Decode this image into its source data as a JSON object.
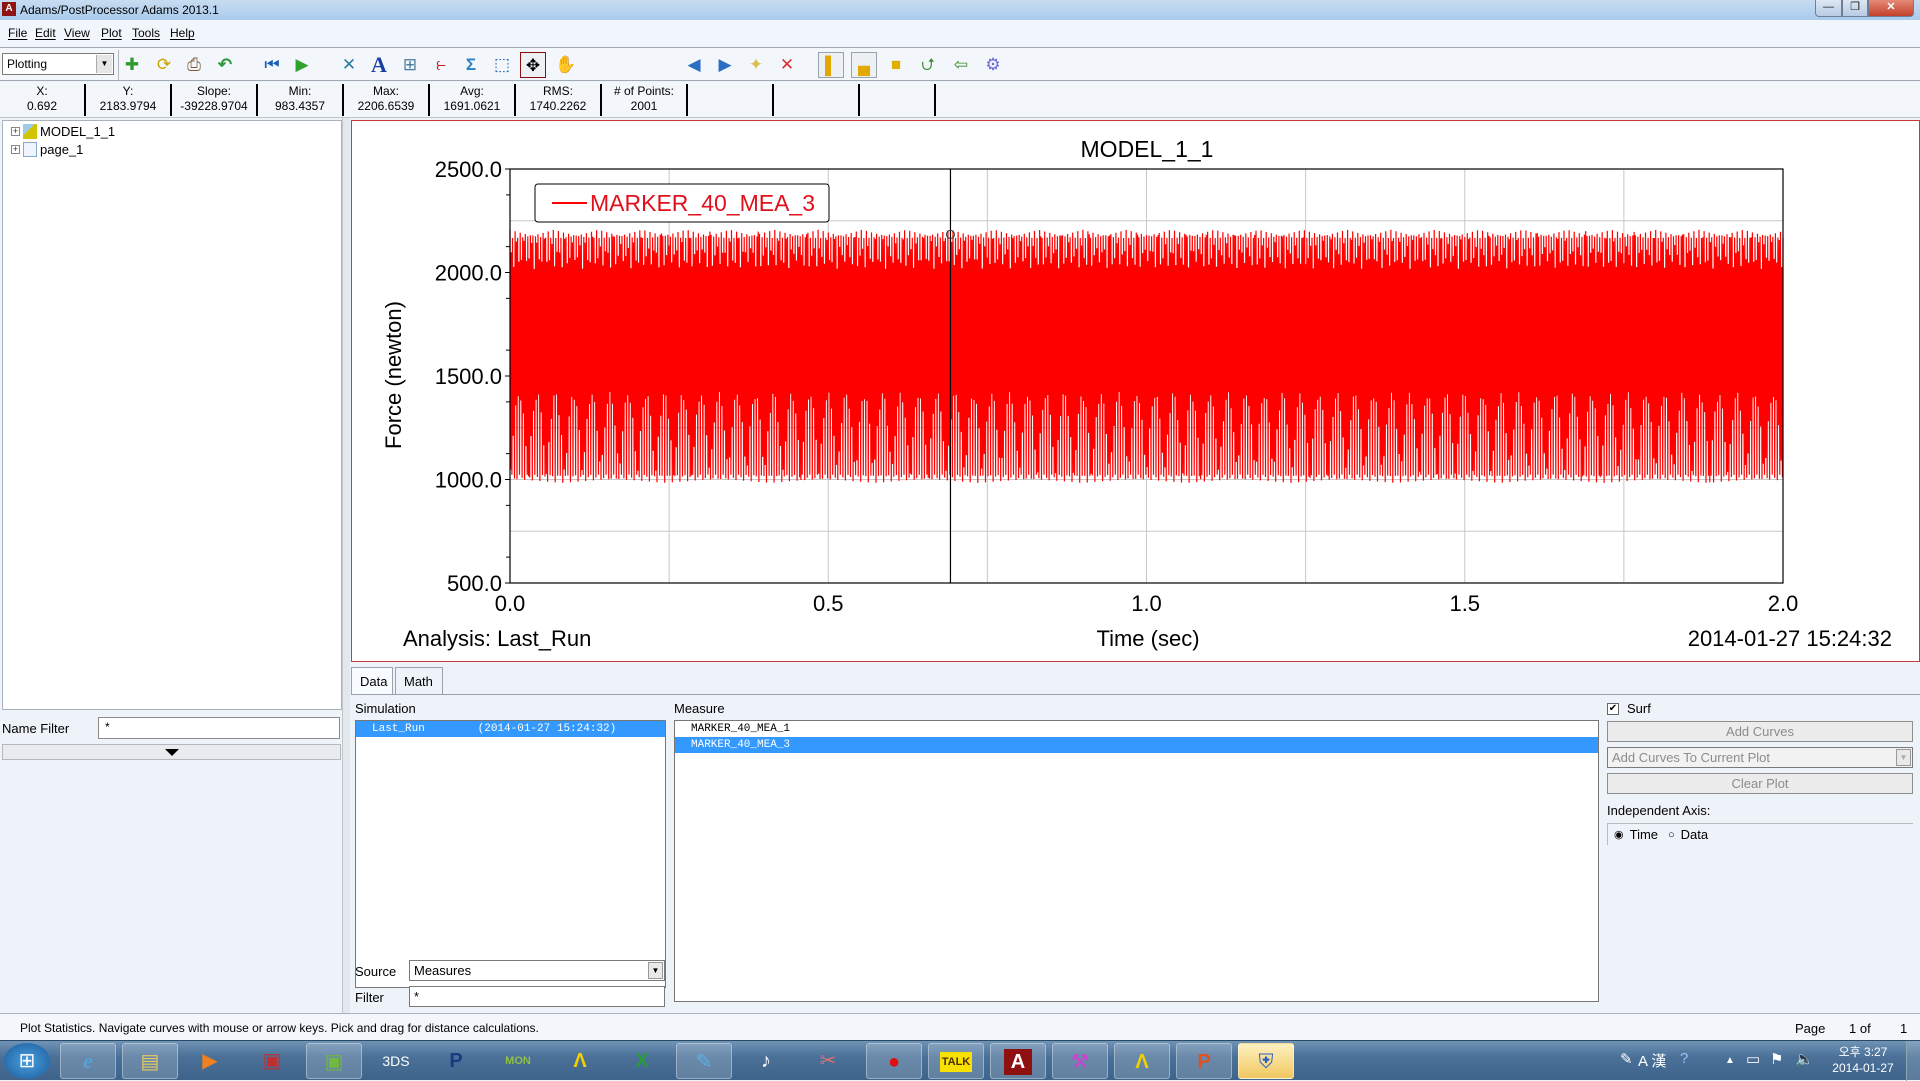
{
  "window": {
    "title": "Adams/PostProcessor Adams 2013.1",
    "app_icon_letter": "A",
    "controls": {
      "minimize": "—",
      "restore": "❐",
      "close": "✕"
    }
  },
  "menu": [
    "File",
    "Edit",
    "View",
    "Plot",
    "Tools",
    "Help"
  ],
  "toolbar": {
    "mode_select": "Plotting",
    "icons": [
      "new-page-icon",
      "reload-icon",
      "print-icon",
      "undo-icon",
      "rewind-icon",
      "play-icon",
      "axes-tool-icon",
      "text-tool-icon",
      "table-icon",
      "curve-edit-icon",
      "statistics-sigma-icon",
      "zoom-box-icon",
      "fit-icon",
      "pan-hand-icon",
      "previous-page-icon",
      "next-page-icon",
      "new-page-blank-icon",
      "delete-page-icon",
      "layout-left-icon",
      "layout-bottom-icon",
      "layout-full-icon",
      "swap-icon",
      "back-arrow-icon",
      "settings-gear-icon"
    ]
  },
  "stats": [
    {
      "label": "X:",
      "value": "0.692"
    },
    {
      "label": "Y:",
      "value": "2183.9794"
    },
    {
      "label": "Slope:",
      "value": "-39228.9704"
    },
    {
      "label": "Min:",
      "value": "983.4357"
    },
    {
      "label": "Max:",
      "value": "2206.6539"
    },
    {
      "label": "Avg:",
      "value": "1691.0621"
    },
    {
      "label": "RMS:",
      "value": "1740.2262"
    },
    {
      "label": "# of Points:",
      "value": "2001"
    },
    {
      "label": "",
      "value": ""
    },
    {
      "label": "",
      "value": ""
    },
    {
      "label": "",
      "value": ""
    }
  ],
  "tree": {
    "items": [
      {
        "label": "MODEL_1_1",
        "icon": "model-icon"
      },
      {
        "label": "page_1",
        "icon": "page-icon"
      }
    ],
    "name_filter_label": "Name Filter",
    "name_filter_value": "*"
  },
  "chart_data": {
    "type": "line",
    "title": "MODEL_1_1",
    "xlabel": "Time (sec)",
    "ylabel": "Force (newton)",
    "xlim": [
      0.0,
      2.0
    ],
    "ylim": [
      500.0,
      2500.0
    ],
    "x_ticks": [
      "0.0",
      "0.5",
      "1.0",
      "1.5",
      "2.0"
    ],
    "y_ticks": [
      "500.0",
      "1000.0",
      "1500.0",
      "2000.0",
      "2500.0"
    ],
    "grid": true,
    "legend": {
      "position": "top-left",
      "entries": [
        "MARKER_40_MEA_3"
      ]
    },
    "series": [
      {
        "name": "MARKER_40_MEA_3",
        "color": "#ff0000",
        "points": 2001,
        "min": 983.4357,
        "max": 2206.6539,
        "avg": 1691.0621,
        "rms": 1740.2262,
        "description": "dense oscillation between ~983 and ~2207 newton over 0–2 sec"
      }
    ],
    "cursor": {
      "x": 0.692,
      "y": 2183.9794
    },
    "footer_left": "Analysis:  Last_Run",
    "footer_right": "2014-01-27 15:24:32"
  },
  "bottom": {
    "tabs": [
      "Data",
      "Math"
    ],
    "active_tab": "Data",
    "simulation_label": "Simulation",
    "simulations": [
      {
        "name": "Last_Run",
        "time": "(2014-01-27 15:24:32)",
        "selected": true
      }
    ],
    "measure_label": "Measure",
    "measures": [
      {
        "name": "MARKER_40_MEA_1",
        "selected": false
      },
      {
        "name": "MARKER_40_MEA_3",
        "selected": true
      }
    ],
    "source_label": "Source",
    "source_value": "Measures",
    "filter_label": "Filter",
    "filter_value": "*",
    "surf_label": "Surf",
    "surf_checked": true,
    "add_curves": "Add Curves",
    "add_mode": "Add Curves To Current Plot",
    "clear_plot": "Clear Plot",
    "independent_axis_label": "Independent Axis:",
    "axis_options": [
      "Time",
      "Data"
    ],
    "axis_selected": "Time"
  },
  "status": {
    "message": "Plot Statistics.  Navigate curves with mouse or arrow keys.  Pick and drag for distance calculations.",
    "page_label": "Page",
    "page_current": "1 of",
    "page_total": "1"
  },
  "taskbar": {
    "apps": [
      "start-orb-icon",
      "internet-explorer-icon",
      "file-explorer-icon",
      "media-player-icon",
      "window-app-icon",
      "window-app-2-icon",
      "3ds-app-icon",
      "p-app-icon",
      "mon-app-icon",
      "adams-view-icon",
      "excel-icon",
      "notepad-app-icon",
      "music-penguin-icon",
      "scissors-app-icon",
      "recorder-icon",
      "kakaotalk-icon",
      "adams-postprocessor-icon",
      "tools-app-icon",
      "adams-2-icon",
      "powerpoint-icon",
      "security-shield-icon"
    ],
    "tray_ime": "A 漢",
    "clock_time": "오후 3:27",
    "clock_date": "2014-01-27"
  }
}
